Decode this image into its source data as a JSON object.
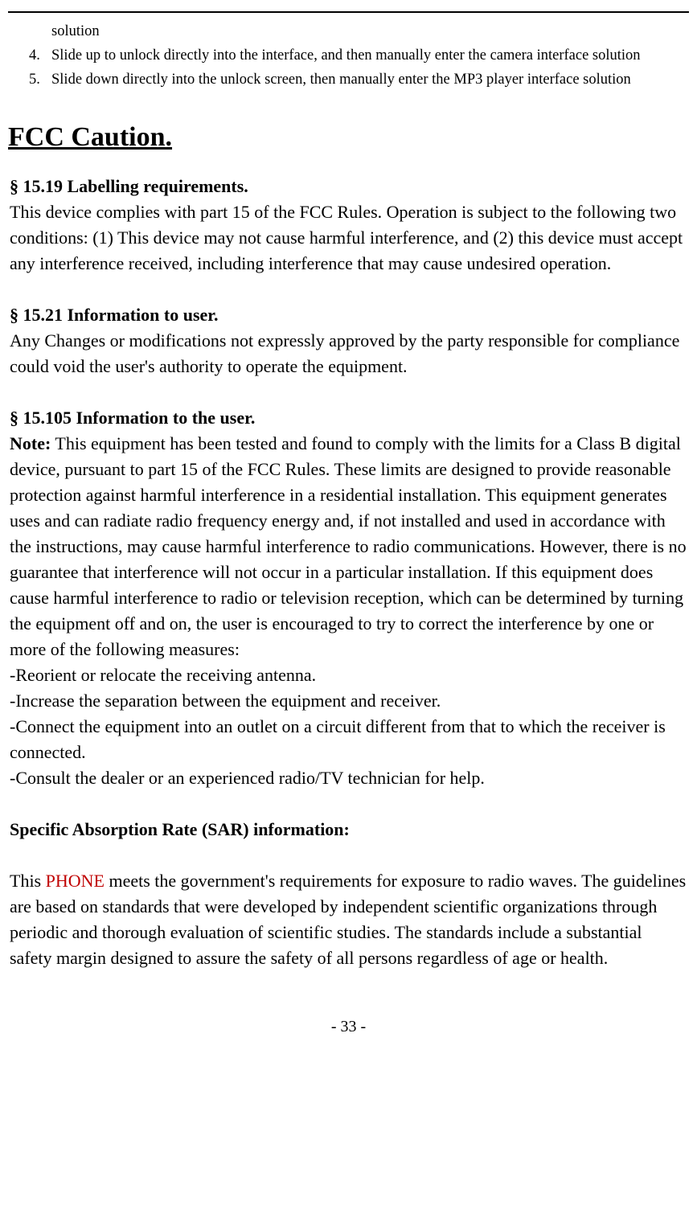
{
  "list": {
    "item3_trail": "solution",
    "item4_num": "4.",
    "item4_text": "Slide up to unlock directly into the interface, and then manually enter the camera interface solution",
    "item5_num": "5.",
    "item5_text": "Slide down directly into the unlock screen, then manually enter the MP3 player interface solution"
  },
  "heading": "FCC Caution.",
  "s1519": {
    "title": "§ 15.19 Labelling requirements.",
    "body": "This device complies with part 15 of the FCC Rules. Operation is subject to the following two conditions: (1) This device may not cause harmful interference, and (2) this device must accept any interference received, including interference that may cause undesired operation."
  },
  "s1521": {
    "title": "§ 15.21 Information to user.",
    "body": "Any Changes or modifications not expressly approved by the party responsible for compliance could void the user's authority to operate the equipment."
  },
  "s15105": {
    "title": "§ 15.105 Information to the user.",
    "note_label": "Note:",
    "body": " This equipment has been tested and found to comply with the limits for a Class B digital device, pursuant to part 15 of the FCC Rules. These limits are designed to provide reasonable protection against harmful interference in a residential installation. This equipment generates uses and can radiate radio frequency energy and, if not installed and used in accordance with the instructions, may cause harmful interference to radio communications. However, there is no guarantee that interference will not occur in a particular installation. If this equipment does cause harmful interference to radio or television reception, which can be determined by turning the equipment off and on, the user is encouraged to try to correct the interference by one or more of the following measures:",
    "m1": "-Reorient or relocate the receiving antenna.",
    "m2": "-Increase the separation between the equipment and receiver.",
    "m3": "-Connect the equipment into an outlet on a circuit different from that to which the receiver is connected.",
    "m4": "-Consult the dealer or an experienced radio/TV technician for help."
  },
  "sar": {
    "title": "Specific Absorption Rate (SAR) information:",
    "pre": "This ",
    "phone": "PHONE",
    "post": " meets the government's requirements for exposure to radio waves. The guidelines are based on standards that were developed by independent scientific organizations through periodic and thorough evaluation of scientific studies. The standards include a substantial safety margin designed to assure the safety of all persons regardless of age or health."
  },
  "footer": "- 33 -"
}
